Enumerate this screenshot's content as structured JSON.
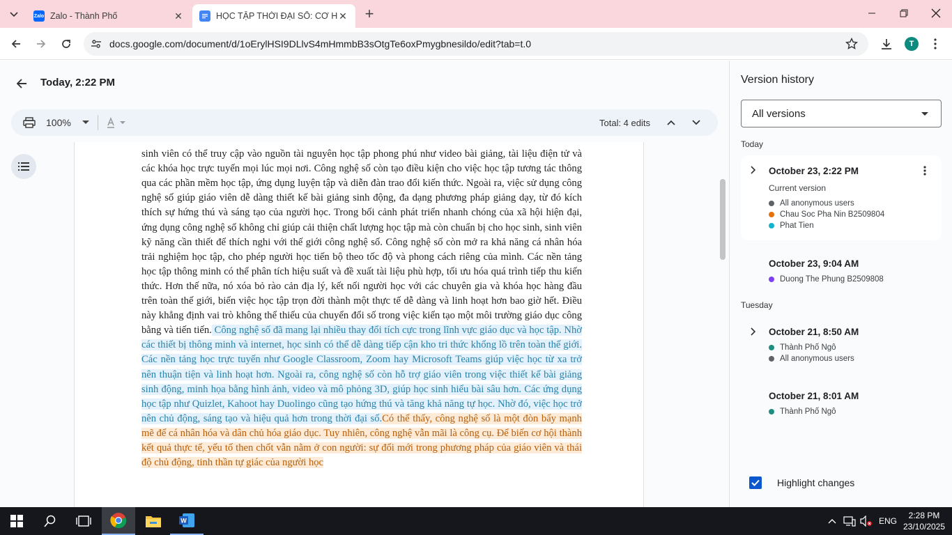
{
  "browser": {
    "tabs": [
      {
        "title": "Zalo - Thành Phố",
        "icon": "zalo-icon",
        "fav_text": "Zalo",
        "color": "#0068ff"
      },
      {
        "title": "HỌC TẬP THỜI ĐẠI SỐ: CƠ HỘ",
        "icon": "docs-icon",
        "color": "#4285f4"
      }
    ],
    "url": "docs.google.com/document/d/1oErylHSI9DLlvS4mHmmbB3sOtgTe6oxPmygbnesildo/edit?tab=t.0",
    "profile_initial": "T"
  },
  "header": {
    "title": "Today, 2:22 PM"
  },
  "toolbar": {
    "zoom": "100%",
    "edits_label": "Total: 4 edits"
  },
  "document": {
    "segments": [
      {
        "text": "…",
        "style": "normal"
      },
      {
        "text": "sinh viên có thể truy cập vào nguồn tài nguyên học tập phong phú như video bài giảng, tài liệu điện tử và các khóa học trực tuyến mọi lúc mọi nơi. Công nghệ số còn tạo điều kiện cho việc học tập tương tác thông qua các phần mềm học tập, ứng dụng luyện tập và diễn đàn trao đổi kiến thức. Ngoài ra, việc sử dụng công nghệ số giúp giáo viên dễ dàng thiết kế bài giảng sinh động, đa dạng phương pháp giảng dạy, từ đó kích thích sự hứng thú và sáng tạo của người học. Trong bối cảnh phát triển nhanh chóng của xã hội hiện đại, ứng dụng công nghệ số không chỉ giúp cải thiện chất lượng học tập mà còn chuẩn bị cho học sinh, sinh viên kỹ năng cần thiết để thích nghi với thế giới công nghệ số. Công nghệ số còn mở ra khả năng cá nhân hóa trải nghiệm học tập, cho phép người học tiến bộ theo tốc độ và phong cách riêng của mình. Các nền tảng học tập thông minh có thể phân tích hiệu suất và đề xuất tài liệu phù hợp, tối ưu hóa quá trình tiếp thu kiến thức. Hơn thế nữa, nó xóa bỏ rào cản địa lý, kết nối người học với các chuyên gia và khóa học hàng đầu trên toàn thế giới, biến việc học tập trọn đời thành một thực tế dễ dàng và linh hoạt hơn bao giờ hết. Điều này khẳng định vai trò không thể thiếu của chuyển đổi số trong việc kiến tạo một môi trường giáo dục công bằng và tiến tiến.",
        "style": "normal"
      },
      {
        "text": " Công nghệ số đã mang lại nhiều thay đổi tích cực trong lĩnh vực giáo dục và học tập. Nhờ các thiết bị thông minh và internet, học sinh có thể dễ dàng tiếp cận kho tri thức khổng lồ trên toàn thế giới. Các nền tảng học trực tuyến như Google Classroom, Zoom hay Microsoft Teams giúp việc học từ xa trở nên thuận tiện và linh hoạt hơn. Ngoài ra, công nghệ số còn hỗ trợ giáo viên trong việc thiết kế bài giảng sinh động, minh họa bằng hình ảnh, video và mô phỏng 3D, giúp học sinh hiểu bài sâu hơn. Các ứng dụng học tập như Quizlet, Kahoot hay Duolingo cũng tạo hứng thú và tăng khả năng tự học. Nhờ đó, việc học trở nên chủ động, sáng tạo và hiệu quả hơn trong thời đại số.",
        "style": "blue"
      },
      {
        "text": "Có thể thấy, công nghệ số là một đòn bẩy mạnh mẽ để cá nhân hóa và dân chủ hóa giáo dục. Tuy nhiên, công nghệ vẫn mãi là công cụ. Để biến cơ hội thành kết quả thực tế, yếu tố then chốt vẫn nằm ở con người: sự đổi mới trong phương pháp của giáo viên và thái độ chủ động, tinh thần tự giác của người học",
        "style": "orange"
      }
    ]
  },
  "version_history": {
    "title": "Version history",
    "filter": "All versions",
    "groups": [
      {
        "label": "Today"
      },
      {
        "label": "Tuesday"
      }
    ],
    "versions": [
      {
        "date": "October 23, 2:22 PM",
        "sub": "Current version",
        "users": [
          {
            "name": "All anonymous users",
            "color": "#5f6368"
          },
          {
            "name": "Chau Soc Pha Nin B2509804",
            "color": "#e8710a"
          },
          {
            "name": "Phat Tien",
            "color": "#12b5cb"
          }
        ]
      },
      {
        "date": "October 23, 9:04 AM",
        "users": [
          {
            "name": "Duong The Phung B2509808",
            "color": "#7e3ff2"
          }
        ]
      },
      {
        "date": "October 21, 8:50 AM",
        "users": [
          {
            "name": "Thành Phố Ngô",
            "color": "#1e8e7e"
          },
          {
            "name": "All anonymous users",
            "color": "#5f6368"
          }
        ]
      },
      {
        "date": "October 21, 8:01 AM",
        "users": [
          {
            "name": "Thành Phố Ngô",
            "color": "#1e8e7e"
          }
        ]
      }
    ],
    "highlight_label": "Highlight changes",
    "highlight_checked": true
  },
  "taskbar": {
    "lang": "ENG",
    "time": "2:28 PM",
    "date": "23/10/2025"
  },
  "colors": {
    "tabbar": "#f9d7dc",
    "accent": "#1a73e8",
    "blue_text": "#2b82a9",
    "orange_text": "#b75e0a"
  }
}
